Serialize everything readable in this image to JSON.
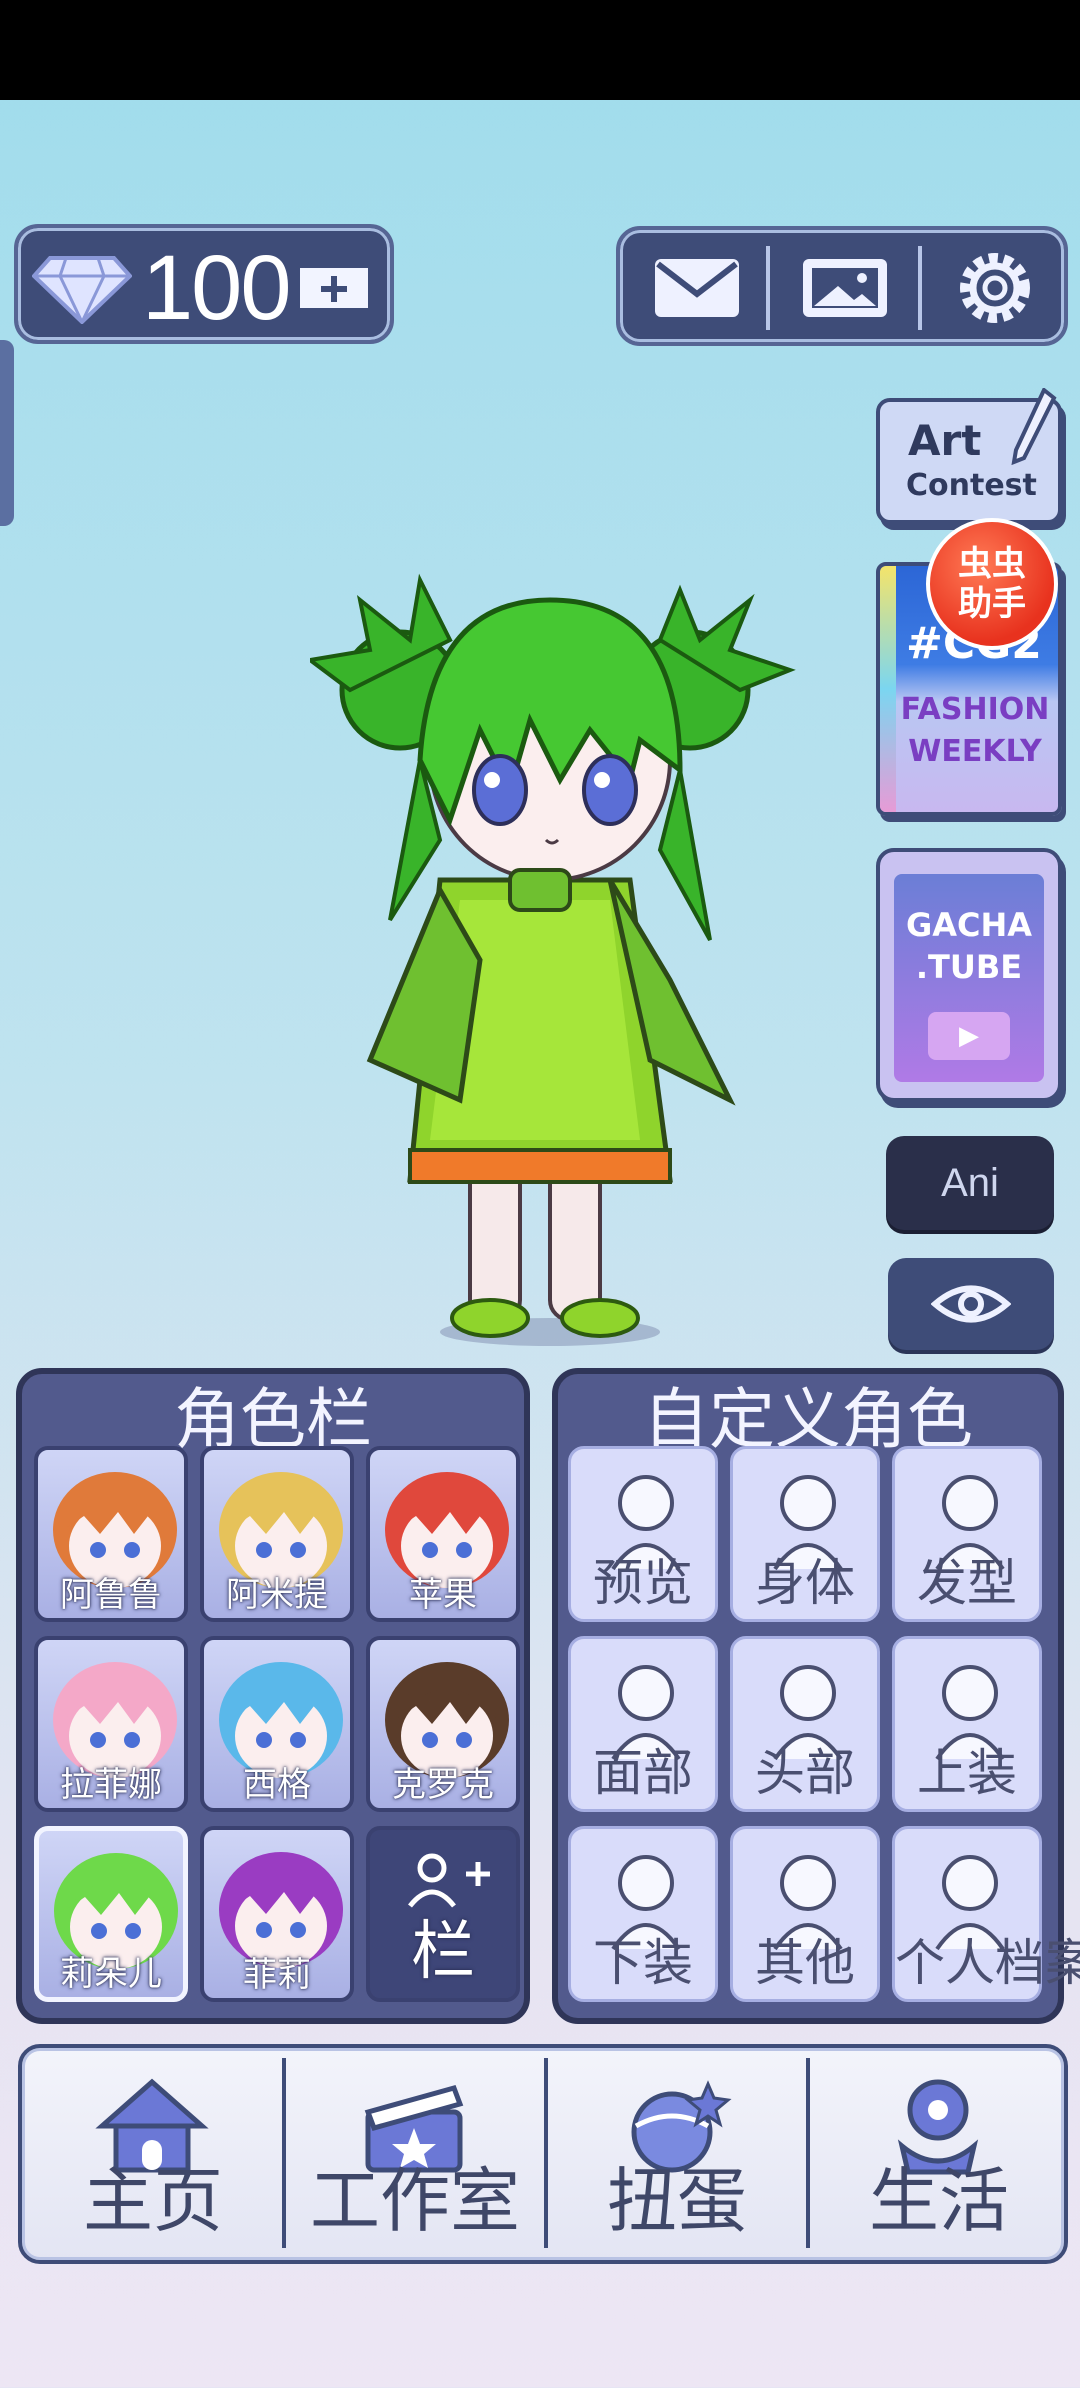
{
  "status_bar": {},
  "currency": {
    "gems": "100"
  },
  "top_buttons": [
    "mail-icon",
    "gallery-icon",
    "settings-icon"
  ],
  "promos": {
    "art_contest": {
      "line1": "Art",
      "line2": "Contest"
    },
    "fashion_weekly": {
      "tag": "#CG2",
      "line1": "FASHION",
      "line2": "WEEKLY"
    },
    "badge": {
      "line1": "虫虫",
      "line2": "助手"
    },
    "gacha_tube": {
      "line1": "GACHA",
      "line2": ".TUBE"
    }
  },
  "ani_button": "Ani",
  "character_slots": {
    "title": "角色栏",
    "items": [
      {
        "label": "阿鲁鲁",
        "hair": "#e07a3a"
      },
      {
        "label": "阿米提",
        "hair": "#e6c25a"
      },
      {
        "label": "苹果",
        "hair": "#e0483c"
      },
      {
        "label": "拉菲娜",
        "hair": "#f4a8c8"
      },
      {
        "label": "西格",
        "hair": "#5ab8ea"
      },
      {
        "label": "克罗克",
        "hair": "#5a3c2a"
      },
      {
        "label": "莉朵儿",
        "hair": "#6ed94a"
      },
      {
        "label": "菲莉",
        "hair": "#9a3cc2"
      }
    ],
    "add_label": "栏"
  },
  "customize": {
    "title": "自定义角色",
    "items": [
      {
        "label": "预览",
        "icon": "preview-icon"
      },
      {
        "label": "身体",
        "icon": "body-icon"
      },
      {
        "label": "发型",
        "icon": "hair-icon"
      },
      {
        "label": "面部",
        "icon": "face-icon"
      },
      {
        "label": "头部",
        "icon": "head-accessory-icon"
      },
      {
        "label": "上装",
        "icon": "top-clothing-icon"
      },
      {
        "label": "下装",
        "icon": "bottom-clothing-icon"
      },
      {
        "label": "其他",
        "icon": "other-icon"
      },
      {
        "label": "个人档案",
        "icon": "profile-icon"
      }
    ]
  },
  "bottom_nav": [
    {
      "label": "主页",
      "icon": "home-icon"
    },
    {
      "label": "工作室",
      "icon": "studio-icon"
    },
    {
      "label": "扭蛋",
      "icon": "gacha-icon"
    },
    {
      "label": "生活",
      "icon": "life-icon"
    }
  ],
  "colors": {
    "accent": "#3e4c78",
    "panel": "#525a8d"
  }
}
